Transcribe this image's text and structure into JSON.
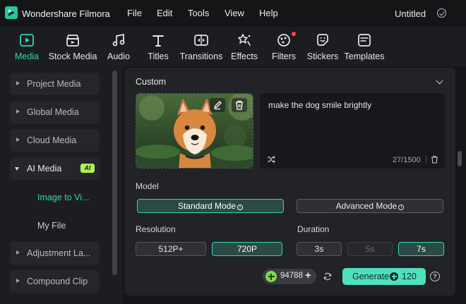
{
  "app": {
    "name": "Wondershare Filmora",
    "document_title": "Untitled"
  },
  "menu": [
    "File",
    "Edit",
    "Tools",
    "View",
    "Help"
  ],
  "toolbar": [
    {
      "label": "Media",
      "active": true
    },
    {
      "label": "Stock Media"
    },
    {
      "label": "Audio"
    },
    {
      "label": "Titles"
    },
    {
      "label": "Transitions"
    },
    {
      "label": "Effects"
    },
    {
      "label": "Filters",
      "notification": true
    },
    {
      "label": "Stickers"
    },
    {
      "label": "Templates"
    }
  ],
  "sidebar": {
    "items": [
      {
        "label": "Project Media"
      },
      {
        "label": "Global Media"
      },
      {
        "label": "Cloud Media"
      },
      {
        "label": "AI Media",
        "badge": "AI",
        "expanded": true
      },
      {
        "label": "Adjustment La..."
      },
      {
        "label": "Compound Clip"
      }
    ],
    "sub_items": [
      {
        "label": "Image to Vi...",
        "selected": true
      },
      {
        "label": "My File"
      }
    ]
  },
  "panel": {
    "section_title": "Custom",
    "prompt": {
      "text": "make the dog smile brightly",
      "counter": "27/1500"
    },
    "model": {
      "label": "Model",
      "options": [
        "Standard Mode",
        "Advanced Mode"
      ],
      "selected": "Standard Mode"
    },
    "resolution": {
      "label": "Resolution",
      "options": [
        "512P+",
        "720P"
      ],
      "selected": "720P"
    },
    "duration": {
      "label": "Duration",
      "options": [
        "3s",
        "5s",
        "7s"
      ],
      "selected": "7s",
      "disabled": [
        "5s"
      ]
    },
    "credits": "94788",
    "generate": {
      "label": "Generate",
      "cost": "120"
    },
    "help": "?"
  },
  "colors": {
    "accent": "#2fd6b4",
    "generate": "#4fe0bf",
    "ai_badge": "#b6ef5a",
    "background": "#141517",
    "panel": "#222327"
  }
}
